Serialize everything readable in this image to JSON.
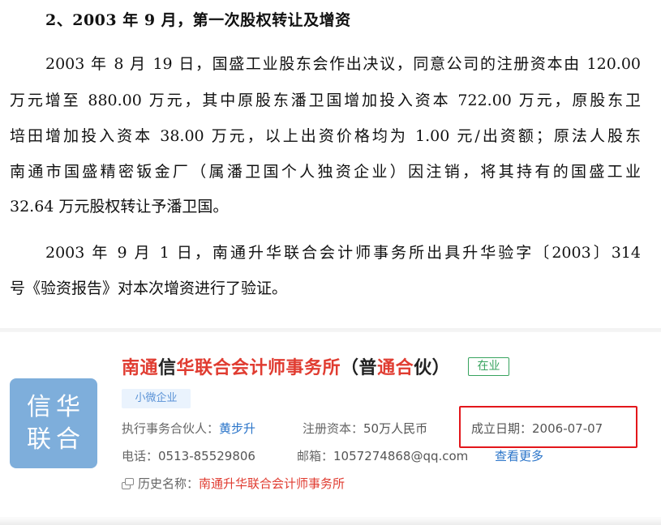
{
  "document": {
    "heading": "2、2003 年 9 月，第一次股权转让及增资",
    "paragraph1": [
      "2003 年 8 月 19 日，国盛工业股东会作出决议，同意公司的注册资本由 120.00",
      "万元增至 880.00 万元，其中原股东潘卫国增加投入资本 722.00 万元，原股东卫",
      "培田增加投入资本 38.00 万元，以上出资价格均为 1.00 元/出资额；原法人股东",
      "南通市国盛精密钣金厂（属潘卫国个人独资企业）因注销，将其持有的国盛工业",
      "32.64 万元股权转让予潘卫国。"
    ],
    "paragraph2": [
      "2003 年 9 月 1 日，南通升华联合会计师事务所出具升华验字〔2003〕314",
      "号《验资报告》对本次增资进行了验证。"
    ]
  },
  "company": {
    "logo_line1": "信华",
    "logo_line2": "联合",
    "name_parts": [
      {
        "text": "南通",
        "highlight": true
      },
      {
        "text": "信",
        "highlight": false
      },
      {
        "text": "华联合会计师事务所",
        "highlight": true
      },
      {
        "text": "（普",
        "highlight": false
      },
      {
        "text": "通合",
        "highlight": true
      },
      {
        "text": "伙）",
        "highlight": false
      }
    ],
    "status": "在业",
    "tag": "小微企业",
    "partner_label": "执行事务合伙人：",
    "partner_value": "黄步升",
    "capital_label": "注册资本：",
    "capital_value": "50万人民币",
    "established_label": "成立日期：",
    "established_value": "2006-07-07",
    "phone_label": "电话：",
    "phone_value": "0513-85529806",
    "email_label": "邮箱：",
    "email_value": "1057274868@qq.com",
    "more_link": "查看更多",
    "history_label": "历史名称：",
    "history_value": "南通升华联合会计师事务所"
  },
  "colors": {
    "highlight_red": "#e03c31",
    "link_blue": "#2a74c9",
    "status_green": "#37a35e",
    "logo_blue": "#7eaedb",
    "annotation_box": "#e3161b"
  },
  "icons": {
    "history": "history-copy-icon"
  }
}
